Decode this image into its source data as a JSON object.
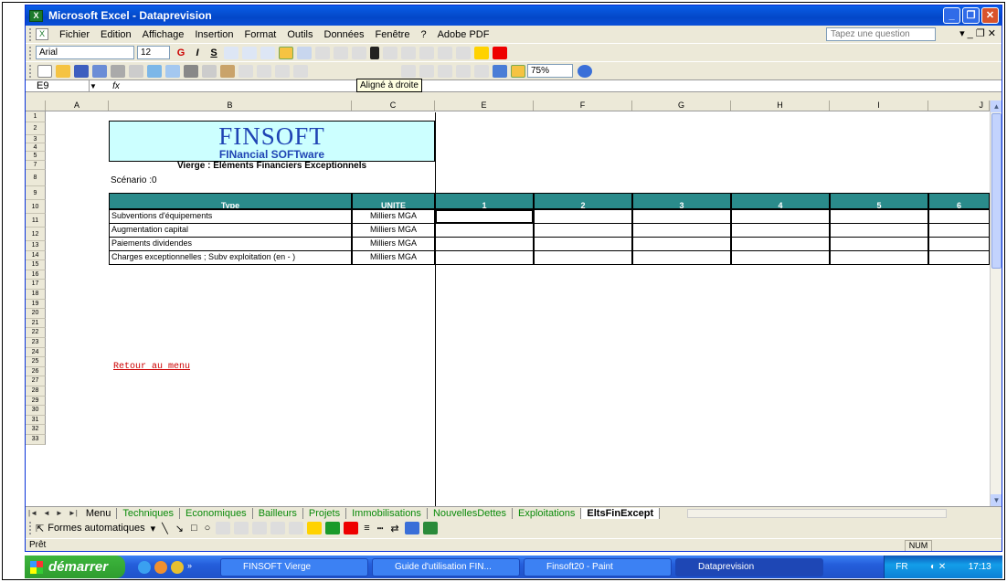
{
  "window": {
    "title": "Microsoft Excel - Dataprevision",
    "app_icon": "excel-icon"
  },
  "menu": [
    "Fichier",
    "Edition",
    "Affichage",
    "Insertion",
    "Format",
    "Outils",
    "Données",
    "Fenêtre",
    "?",
    "Adobe PDF"
  ],
  "question_box": "Tapez une question",
  "format_toolbar": {
    "font": "Arial",
    "size": "12"
  },
  "standard_toolbar": {
    "zoom": "75%",
    "tooltip": "Aligné à droite"
  },
  "formula_bar": {
    "name_box": "E9",
    "fx": "fx"
  },
  "columns": [
    "A",
    "B",
    "C",
    "E",
    "F",
    "G",
    "H",
    "I",
    "J"
  ],
  "rows": [
    "1",
    "2",
    "3",
    "4",
    "5",
    "7",
    "8",
    "9",
    "10",
    "11",
    "12",
    "13",
    "14",
    "15",
    "16",
    "17",
    "18",
    "19",
    "20",
    "21",
    "22",
    "23",
    "24",
    "25",
    "26",
    "27",
    "28",
    "29",
    "30",
    "31",
    "32",
    "33"
  ],
  "header": {
    "logo": "FINSOFT",
    "subtitle": "FINancial SOFTware",
    "title": "Vierge : Eléments Financiers Exceptionnels",
    "scenario": "Scénario :0"
  },
  "table": {
    "headers": [
      "Type",
      "UNITE",
      "1",
      "2",
      "3",
      "4",
      "5",
      "6"
    ],
    "rows": [
      {
        "type": "Subventions d'équipements",
        "unit": "Milliers MGA"
      },
      {
        "type": "Augmentation capital",
        "unit": "Milliers MGA"
      },
      {
        "type": "Paiements dividendes",
        "unit": "Milliers MGA"
      },
      {
        "type": "Charges exceptionnelles ; Subv exploitation (en - )",
        "unit": "Milliers MGA"
      }
    ]
  },
  "link": "Retour au menu",
  "sheet_tabs": [
    "Menu",
    "Techniques",
    "Economiques",
    "Bailleurs",
    "Projets",
    "Immobilisations",
    "NouvellesDettes",
    "Exploitations",
    "EltsFinExcept"
  ],
  "active_tab": "EltsFinExcept",
  "drawing": {
    "shapes": "Formes automatiques"
  },
  "status": {
    "text": "Prêt",
    "num": "NUM"
  },
  "taskbar": {
    "start": "démarrer",
    "tasks": [
      "FINSOFT Vierge",
      "Guide d'utilisation FIN...",
      "Finsoft20 - Paint",
      "Dataprevision"
    ],
    "lang": "FR",
    "clock": "17:13"
  }
}
